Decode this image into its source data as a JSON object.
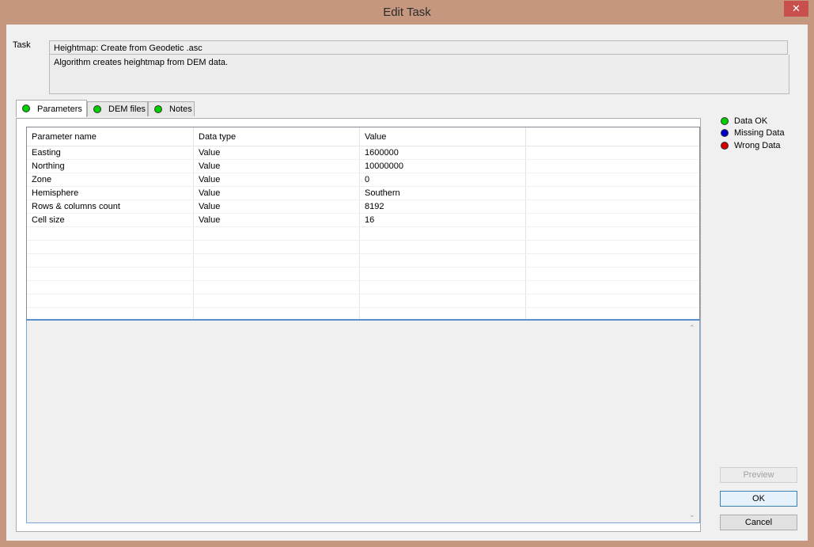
{
  "window": {
    "title": "Edit Task",
    "close_glyph": "✕"
  },
  "task": {
    "label": "Task",
    "name": "Heightmap: Create from Geodetic .asc",
    "description": "Algorithm creates heightmap from DEM data."
  },
  "tabs": [
    {
      "label": "Parameters",
      "status_color": "#00d000",
      "active": true
    },
    {
      "label": "DEM files",
      "status_color": "#00d000",
      "active": false
    },
    {
      "label": "Notes",
      "status_color": "#00d000",
      "active": false
    }
  ],
  "table": {
    "columns": [
      "Parameter name",
      "Data type",
      "Value"
    ],
    "rows": [
      [
        "Easting",
        "Value",
        "1600000"
      ],
      [
        "Northing",
        "Value",
        "10000000"
      ],
      [
        "Zone",
        "Value",
        "0"
      ],
      [
        "Hemisphere",
        "Value",
        "Southern"
      ],
      [
        "Rows & columns count",
        "Value",
        "8192"
      ],
      [
        "Cell size",
        "Value",
        "16"
      ]
    ]
  },
  "legend": [
    {
      "label": "Data OK",
      "color": "#00d000"
    },
    {
      "label": "Missing Data",
      "color": "#0000cc"
    },
    {
      "label": "Wrong Data",
      "color": "#d00000"
    }
  ],
  "buttons": {
    "preview": "Preview",
    "ok": "OK",
    "cancel": "Cancel"
  }
}
